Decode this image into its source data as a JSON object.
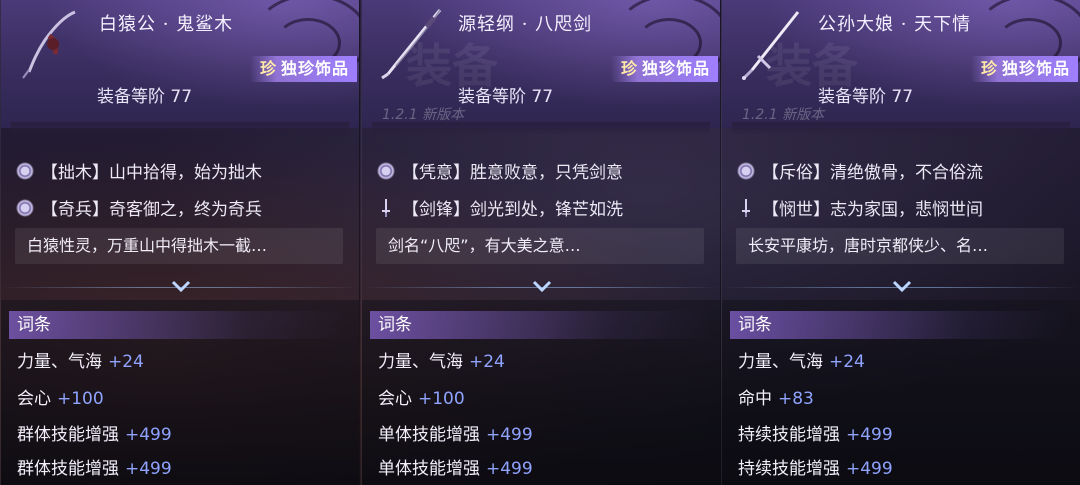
{
  "cards": [
    {
      "title": "白猿公 · 鬼鲨木",
      "rarity_prefix": "珍",
      "rarity_text": "独珍饰品",
      "grade": "装备等阶 77",
      "icon": "whip-icon",
      "effects": [
        {
          "icon": "flower-icon",
          "text": "【拙木】山中拾得，始为拙木"
        },
        {
          "icon": "flower-icon",
          "text": "【奇兵】奇客御之，终为奇兵"
        }
      ],
      "description": "白猿性灵，万重山中得拙木一截…",
      "stats_header": "词条",
      "stats": [
        {
          "name": "力量、气海",
          "value": "+24"
        },
        {
          "name": "会心",
          "value": "+100"
        },
        {
          "name": "群体技能增强",
          "value": "+499"
        },
        {
          "name": "群体技能增强",
          "value": "+499"
        }
      ]
    },
    {
      "title": "源轻纲 · 八咫剑",
      "rarity_prefix": "珍",
      "rarity_text": "独珍饰品",
      "grade": "装备等阶 77",
      "icon": "curved-sword-icon",
      "effects": [
        {
          "icon": "flower-icon",
          "text": "【凭意】胜意败意，只凭剑意"
        },
        {
          "icon": "sword-icon",
          "text": "【剑锋】剑光到处，锋芒如洗"
        }
      ],
      "description": "剑名“八咫”，有大美之意…",
      "stats_header": "词条",
      "stats": [
        {
          "name": "力量、气海",
          "value": "+24"
        },
        {
          "name": "会心",
          "value": "+100"
        },
        {
          "name": "单体技能增强",
          "value": "+499"
        },
        {
          "name": "单体技能增强",
          "value": "+499"
        }
      ]
    },
    {
      "title": "公孙大娘 · 天下情",
      "rarity_prefix": "珍",
      "rarity_text": "独珍饰品",
      "grade": "装备等阶 77",
      "icon": "straight-sword-icon",
      "effects": [
        {
          "icon": "flower-icon",
          "text": "【斥俗】清绝傲骨，不合俗流"
        },
        {
          "icon": "sword-icon",
          "text": "【悯世】志为家国，悲悯世间"
        }
      ],
      "description": "长安平康坊，唐时京都侠少、名…",
      "stats_header": "词条",
      "stats": [
        {
          "name": "力量、气海",
          "value": "+24"
        },
        {
          "name": "命中",
          "value": "+83"
        },
        {
          "name": "持续技能增强",
          "value": "+499"
        },
        {
          "name": "持续技能增强",
          "value": "+499"
        }
      ]
    }
  ],
  "watermark": {
    "big": "装备",
    "version": "1.2.1 新版本"
  },
  "colors": {
    "header": "#4a3a78",
    "rarity_badge": "#9f7fff",
    "stat_value": "#8fa3ff",
    "stats_header": "#9a70e6"
  }
}
